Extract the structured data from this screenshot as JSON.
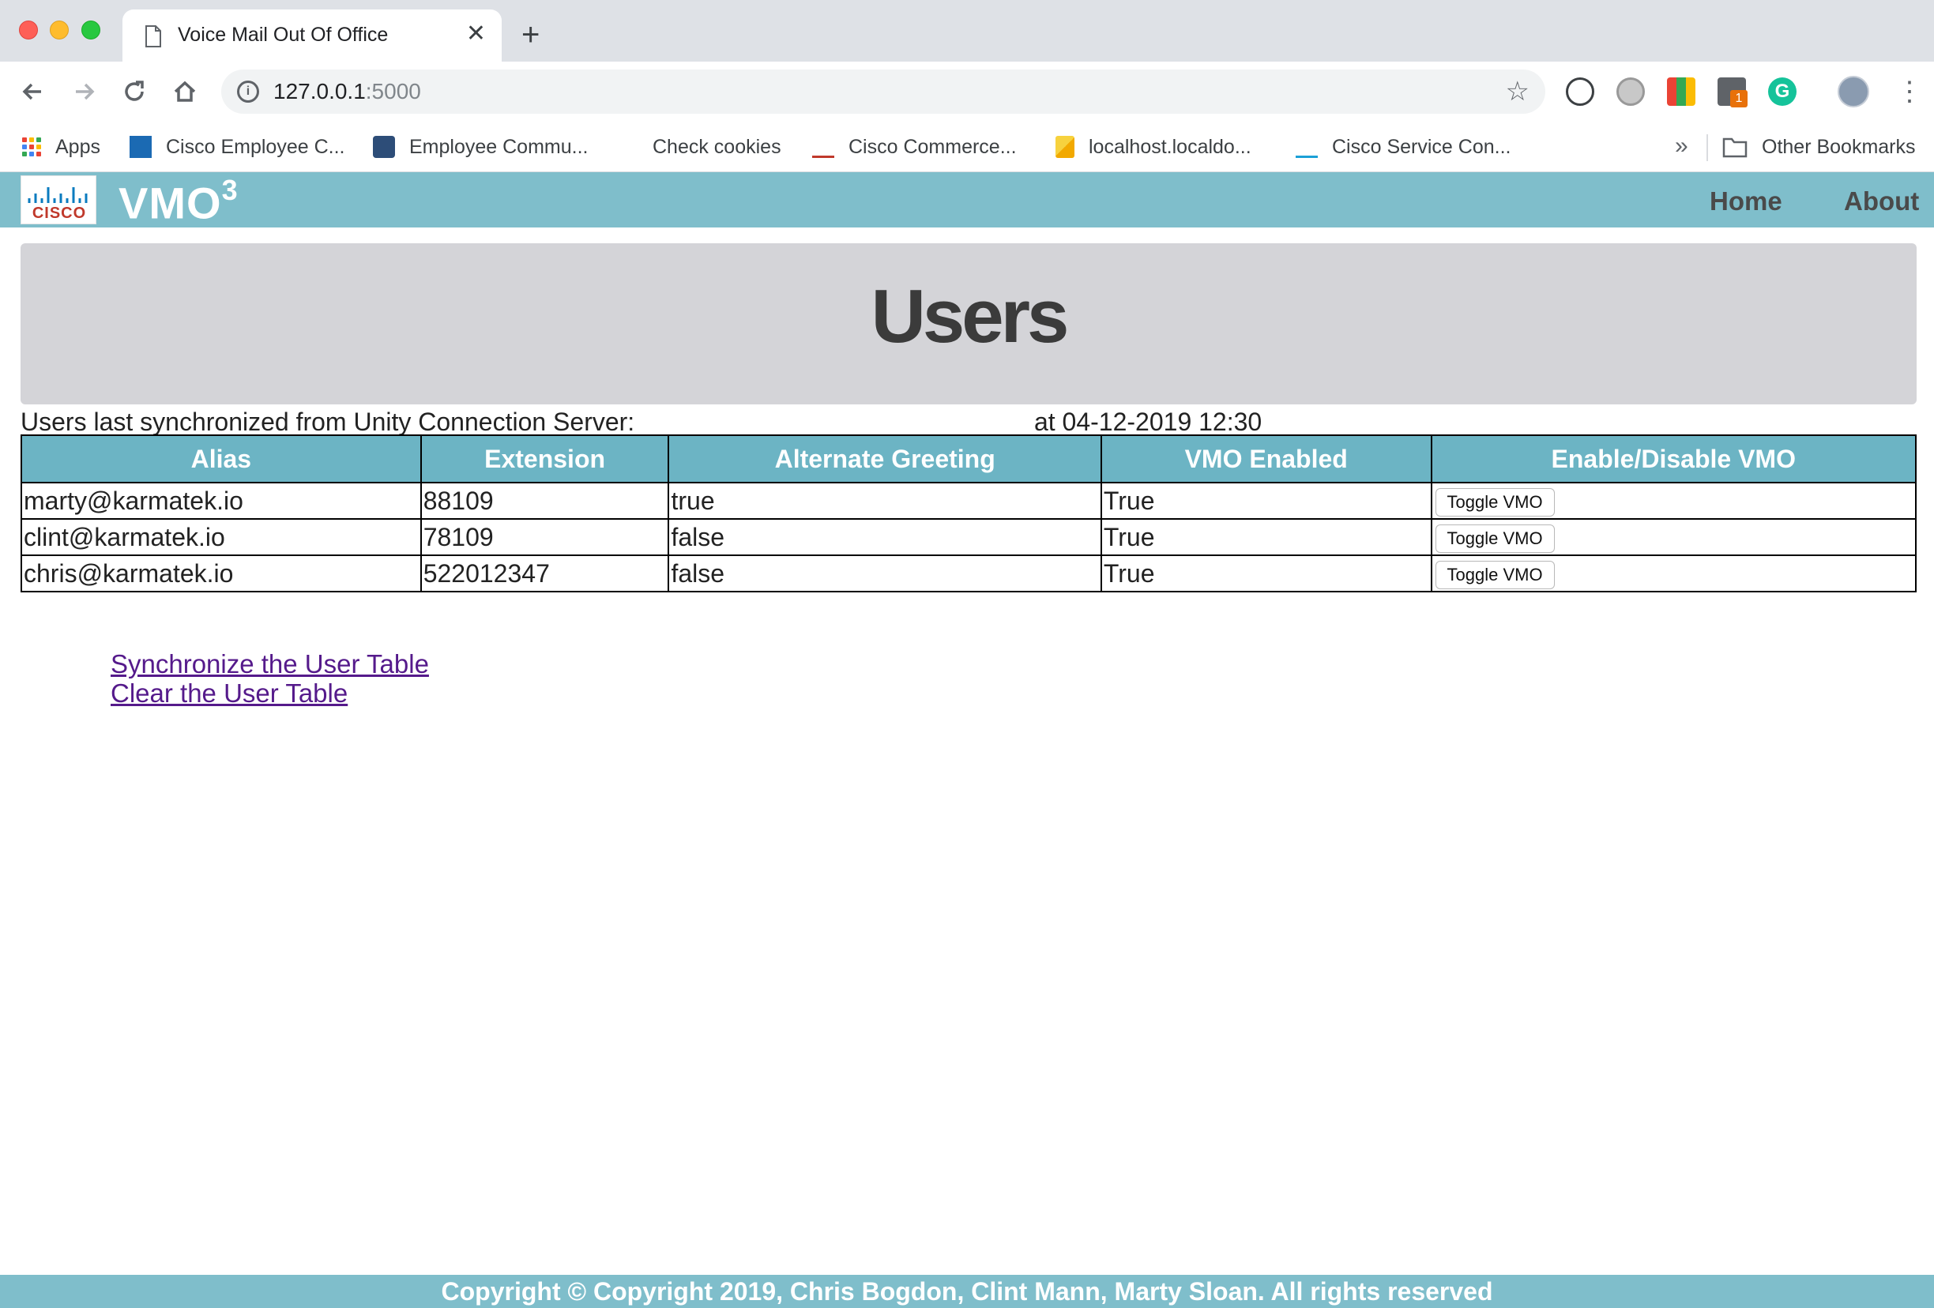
{
  "browser": {
    "tab_title": "Voice Mail Out Of Office",
    "url_host": "127.0.0.1",
    "url_port": ":5000",
    "bookmarks": {
      "apps": "Apps",
      "b1": "Cisco Employee C...",
      "b2": "Employee Commu...",
      "b3": "Check cookies",
      "b4": "Cisco Commerce...",
      "b5": "localhost.localdo...",
      "b6": "Cisco Service Con...",
      "more": "»",
      "other": "Other Bookmarks"
    },
    "extension_badge": "1"
  },
  "navbar": {
    "brand": "VMO",
    "brand_sup": "3",
    "logo_text": "CISCO",
    "home": "Home",
    "about": "About"
  },
  "hero": {
    "title": "Users"
  },
  "sync": {
    "prefix": "Users last synchronized from Unity Connection Server:",
    "suffix": "at 04-12-2019 12:30"
  },
  "table": {
    "headers": [
      "Alias",
      "Extension",
      "Alternate Greeting",
      "VMO Enabled",
      "Enable/Disable VMO"
    ],
    "rows": [
      {
        "alias": "marty@karmatek.io",
        "extension": "88109",
        "alt_greeting": "true",
        "vmo_enabled": "True",
        "button": "Toggle VMO"
      },
      {
        "alias": "clint@karmatek.io",
        "extension": "78109",
        "alt_greeting": "false",
        "vmo_enabled": "True",
        "button": "Toggle VMO"
      },
      {
        "alias": "chris@karmatek.io",
        "extension": "522012347",
        "alt_greeting": "false",
        "vmo_enabled": "True",
        "button": "Toggle VMO"
      }
    ]
  },
  "links": {
    "sync": "Synchronize the User Table",
    "clear": "Clear the User Table"
  },
  "footer": {
    "text": "Copyright © Copyright 2019, Chris Bogdon, Clint Mann, Marty Sloan. All rights reserved"
  },
  "colors": {
    "navbar": "#7fbecb",
    "table_header": "#6cb4c4",
    "hero": "#d4d4d8",
    "link_visited": "#551a8b"
  }
}
